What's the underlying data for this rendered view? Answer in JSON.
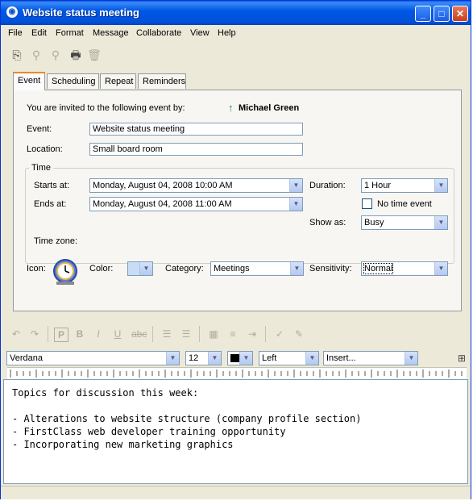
{
  "window": {
    "title": "Website status meeting"
  },
  "menu": [
    "File",
    "Edit",
    "Format",
    "Message",
    "Collaborate",
    "View",
    "Help"
  ],
  "tabs": [
    "Event",
    "Scheduling",
    "Repeat",
    "Reminders"
  ],
  "event": {
    "invite_text": "You are invited to the following event by:",
    "organizer": "Michael Green",
    "event_label": "Event:",
    "event_value": "Website status meeting",
    "location_label": "Location:",
    "location_value": "Small board room"
  },
  "time": {
    "group_label": "Time",
    "starts_label": "Starts at:",
    "starts_value": "Monday, August 04, 2008 10:00 AM",
    "ends_label": "Ends at:",
    "ends_value": "Monday, August 04, 2008 11:00 AM",
    "duration_label": "Duration:",
    "duration_value": "1 Hour",
    "no_time_label": "No time event",
    "show_as_label": "Show as:",
    "show_as_value": "Busy",
    "timezone_label": "Time zone:"
  },
  "props": {
    "icon_label": "Icon:",
    "color_label": "Color:",
    "category_label": "Category:",
    "category_value": "Meetings",
    "sensitivity_label": "Sensitivity:",
    "sensitivity_value": "Normal"
  },
  "format": {
    "font": "Verdana",
    "size": "12",
    "align": "Left",
    "insert": "Insert..."
  },
  "body_lines": [
    "Topics for discussion this week:",
    "",
    "- Alterations to website structure (company profile section)",
    "- FirstClass web developer training opportunity",
    "- Incorporating new marketing graphics"
  ],
  "colors": {
    "title_bar": "#0058e6",
    "tab_accent": "#e68b2c",
    "organizer_icon": "#2e8b2e"
  }
}
